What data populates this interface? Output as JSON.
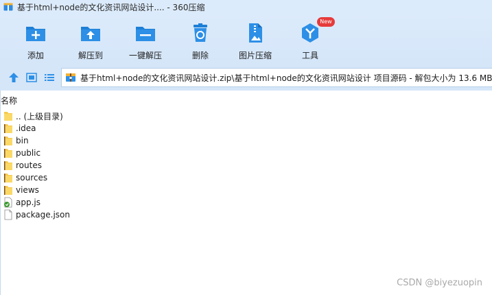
{
  "window": {
    "title": "基于html+node的文化资讯网站设计.... - 360压缩"
  },
  "toolbar": {
    "items": [
      {
        "label": "添加",
        "icon": "add-icon"
      },
      {
        "label": "解压到",
        "icon": "extract-to-icon"
      },
      {
        "label": "一键解压",
        "icon": "one-click-extract-icon"
      },
      {
        "label": "删除",
        "icon": "delete-icon"
      },
      {
        "label": "图片压缩",
        "icon": "image-compress-icon"
      },
      {
        "label": "工具",
        "icon": "tools-icon",
        "badge": "New"
      }
    ],
    "accent": "#1e7fd6"
  },
  "address": {
    "path": "基于html+node的文化资讯网站设计.zip\\基于html+node的文化资讯网站设计 项目源码 - 解包大小为 13.6 MB"
  },
  "filelist": {
    "column_name": "名称",
    "rows": [
      {
        "name": ".. (上级目录)",
        "icon": "folder-icon"
      },
      {
        "name": ".idea",
        "icon": "folder-icon"
      },
      {
        "name": "bin",
        "icon": "folder-icon"
      },
      {
        "name": "public",
        "icon": "folder-icon"
      },
      {
        "name": "routes",
        "icon": "folder-icon"
      },
      {
        "name": "sources",
        "icon": "folder-icon"
      },
      {
        "name": "views",
        "icon": "folder-icon"
      },
      {
        "name": "app.js",
        "icon": "js-file-icon"
      },
      {
        "name": "package.json",
        "icon": "file-icon"
      }
    ]
  },
  "watermark": "CSDN @biyezuopin"
}
